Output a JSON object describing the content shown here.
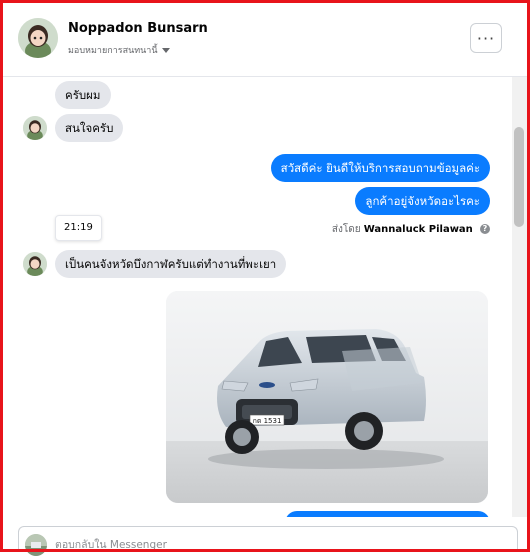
{
  "header": {
    "name": "Noppadon Bunsarn",
    "assigned_label": "มอบหมายการสนทนานี้",
    "more_label": "···"
  },
  "messages": {
    "m1": "ครับผม",
    "m2": "สนใจครับ",
    "m3": "สวัสดีค่ะ  ยินดีให้บริการสอบถามข้อมูลค่ะ",
    "m4": "ลูกค้าอยู่จังหวัดอะไรคะ",
    "sent_by_prefix": "ส่งโดย",
    "sent_by_name": "Wannaluck Pilawan",
    "timestamp": "21:19",
    "m5": "เป็นคนจังหวัดบึงกาฬครับแต่ทำงานที่พะเยา",
    "photo_plate": "กต 1531"
  },
  "composer": {
    "placeholder": "ตอบกลับใน Messenger"
  },
  "colors": {
    "frame": "#e8141b",
    "outgoing_bubble": "#0a7cff",
    "incoming_bubble": "#e4e6eb"
  },
  "icons": [
    "more-icon",
    "caret-down-icon",
    "info-icon"
  ]
}
